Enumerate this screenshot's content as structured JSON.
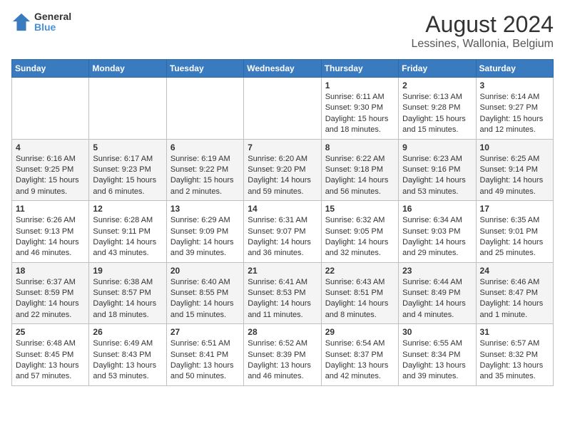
{
  "header": {
    "logo_line1": "General",
    "logo_line2": "Blue",
    "title": "August 2024",
    "subtitle": "Lessines, Wallonia, Belgium"
  },
  "days_of_week": [
    "Sunday",
    "Monday",
    "Tuesday",
    "Wednesday",
    "Thursday",
    "Friday",
    "Saturday"
  ],
  "weeks": [
    {
      "days": [
        {
          "num": "",
          "info": ""
        },
        {
          "num": "",
          "info": ""
        },
        {
          "num": "",
          "info": ""
        },
        {
          "num": "",
          "info": ""
        },
        {
          "num": "1",
          "info": "Sunrise: 6:11 AM\nSunset: 9:30 PM\nDaylight: 15 hours and 18 minutes."
        },
        {
          "num": "2",
          "info": "Sunrise: 6:13 AM\nSunset: 9:28 PM\nDaylight: 15 hours and 15 minutes."
        },
        {
          "num": "3",
          "info": "Sunrise: 6:14 AM\nSunset: 9:27 PM\nDaylight: 15 hours and 12 minutes."
        }
      ]
    },
    {
      "days": [
        {
          "num": "4",
          "info": "Sunrise: 6:16 AM\nSunset: 9:25 PM\nDaylight: 15 hours and 9 minutes."
        },
        {
          "num": "5",
          "info": "Sunrise: 6:17 AM\nSunset: 9:23 PM\nDaylight: 15 hours and 6 minutes."
        },
        {
          "num": "6",
          "info": "Sunrise: 6:19 AM\nSunset: 9:22 PM\nDaylight: 15 hours and 2 minutes."
        },
        {
          "num": "7",
          "info": "Sunrise: 6:20 AM\nSunset: 9:20 PM\nDaylight: 14 hours and 59 minutes."
        },
        {
          "num": "8",
          "info": "Sunrise: 6:22 AM\nSunset: 9:18 PM\nDaylight: 14 hours and 56 minutes."
        },
        {
          "num": "9",
          "info": "Sunrise: 6:23 AM\nSunset: 9:16 PM\nDaylight: 14 hours and 53 minutes."
        },
        {
          "num": "10",
          "info": "Sunrise: 6:25 AM\nSunset: 9:14 PM\nDaylight: 14 hours and 49 minutes."
        }
      ]
    },
    {
      "days": [
        {
          "num": "11",
          "info": "Sunrise: 6:26 AM\nSunset: 9:13 PM\nDaylight: 14 hours and 46 minutes."
        },
        {
          "num": "12",
          "info": "Sunrise: 6:28 AM\nSunset: 9:11 PM\nDaylight: 14 hours and 43 minutes."
        },
        {
          "num": "13",
          "info": "Sunrise: 6:29 AM\nSunset: 9:09 PM\nDaylight: 14 hours and 39 minutes."
        },
        {
          "num": "14",
          "info": "Sunrise: 6:31 AM\nSunset: 9:07 PM\nDaylight: 14 hours and 36 minutes."
        },
        {
          "num": "15",
          "info": "Sunrise: 6:32 AM\nSunset: 9:05 PM\nDaylight: 14 hours and 32 minutes."
        },
        {
          "num": "16",
          "info": "Sunrise: 6:34 AM\nSunset: 9:03 PM\nDaylight: 14 hours and 29 minutes."
        },
        {
          "num": "17",
          "info": "Sunrise: 6:35 AM\nSunset: 9:01 PM\nDaylight: 14 hours and 25 minutes."
        }
      ]
    },
    {
      "days": [
        {
          "num": "18",
          "info": "Sunrise: 6:37 AM\nSunset: 8:59 PM\nDaylight: 14 hours and 22 minutes."
        },
        {
          "num": "19",
          "info": "Sunrise: 6:38 AM\nSunset: 8:57 PM\nDaylight: 14 hours and 18 minutes."
        },
        {
          "num": "20",
          "info": "Sunrise: 6:40 AM\nSunset: 8:55 PM\nDaylight: 14 hours and 15 minutes."
        },
        {
          "num": "21",
          "info": "Sunrise: 6:41 AM\nSunset: 8:53 PM\nDaylight: 14 hours and 11 minutes."
        },
        {
          "num": "22",
          "info": "Sunrise: 6:43 AM\nSunset: 8:51 PM\nDaylight: 14 hours and 8 minutes."
        },
        {
          "num": "23",
          "info": "Sunrise: 6:44 AM\nSunset: 8:49 PM\nDaylight: 14 hours and 4 minutes."
        },
        {
          "num": "24",
          "info": "Sunrise: 6:46 AM\nSunset: 8:47 PM\nDaylight: 14 hours and 1 minute."
        }
      ]
    },
    {
      "days": [
        {
          "num": "25",
          "info": "Sunrise: 6:48 AM\nSunset: 8:45 PM\nDaylight: 13 hours and 57 minutes."
        },
        {
          "num": "26",
          "info": "Sunrise: 6:49 AM\nSunset: 8:43 PM\nDaylight: 13 hours and 53 minutes."
        },
        {
          "num": "27",
          "info": "Sunrise: 6:51 AM\nSunset: 8:41 PM\nDaylight: 13 hours and 50 minutes."
        },
        {
          "num": "28",
          "info": "Sunrise: 6:52 AM\nSunset: 8:39 PM\nDaylight: 13 hours and 46 minutes."
        },
        {
          "num": "29",
          "info": "Sunrise: 6:54 AM\nSunset: 8:37 PM\nDaylight: 13 hours and 42 minutes."
        },
        {
          "num": "30",
          "info": "Sunrise: 6:55 AM\nSunset: 8:34 PM\nDaylight: 13 hours and 39 minutes."
        },
        {
          "num": "31",
          "info": "Sunrise: 6:57 AM\nSunset: 8:32 PM\nDaylight: 13 hours and 35 minutes."
        }
      ]
    }
  ]
}
